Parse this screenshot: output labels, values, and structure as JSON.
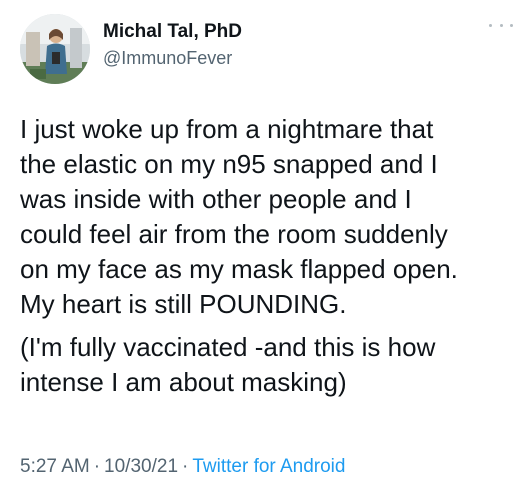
{
  "author": {
    "display_name": "Michal Tal, PhD",
    "handle": "@ImmunoFever",
    "avatar_icon": "profile-photo"
  },
  "more_icon": "ellipsis-icon",
  "tweet": {
    "paragraph1": [
      "I just woke up from a nightmare that",
      "the elastic on my n95 snapped and I",
      "was inside with other people and I",
      "could feel air from the room suddenly",
      "on my face as my mask flapped open.",
      "My heart is still POUNDING."
    ],
    "paragraph2": [
      "(I'm fully vaccinated -and this is how",
      "intense I am about masking)"
    ]
  },
  "meta": {
    "time": "5:27 AM",
    "separator": "·",
    "date": "10/30/21",
    "source": "Twitter for Android"
  },
  "colors": {
    "text": "#0f1419",
    "secondary": "#536471",
    "link": "#1d9bf0"
  }
}
